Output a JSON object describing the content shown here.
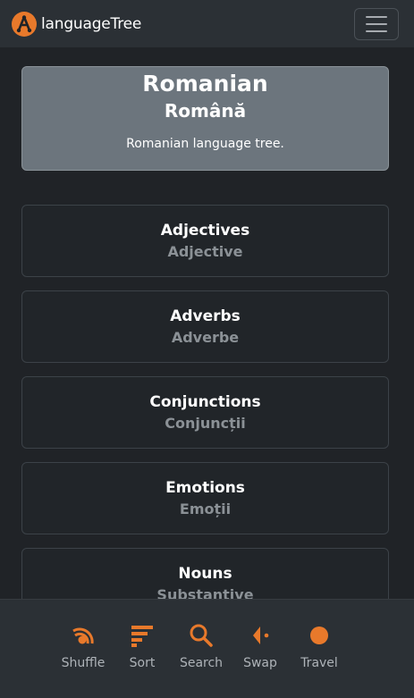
{
  "navbar": {
    "brand": "languageTree"
  },
  "hero": {
    "title": "Romanian",
    "native": "Română",
    "description": "Romanian language tree."
  },
  "categories": [
    {
      "name": "Adjectives",
      "native": "Adjective"
    },
    {
      "name": "Adverbs",
      "native": "Adverbe"
    },
    {
      "name": "Conjunctions",
      "native": "Conjuncții"
    },
    {
      "name": "Emotions",
      "native": "Emoții"
    },
    {
      "name": "Nouns",
      "native": "Substantive"
    }
  ],
  "bottom_nav": [
    {
      "label": "Shuffle",
      "icon": "shuffle-icon"
    },
    {
      "label": "Sort",
      "icon": "sort-icon"
    },
    {
      "label": "Search",
      "icon": "search-icon"
    },
    {
      "label": "Swap",
      "icon": "swap-icon"
    },
    {
      "label": "Travel",
      "icon": "travel-icon"
    }
  ],
  "colors": {
    "accent": "#e8792b",
    "background": "#202327",
    "navbar": "#2b3035",
    "hero": "#6c757d",
    "muted_text": "#8b9196"
  }
}
